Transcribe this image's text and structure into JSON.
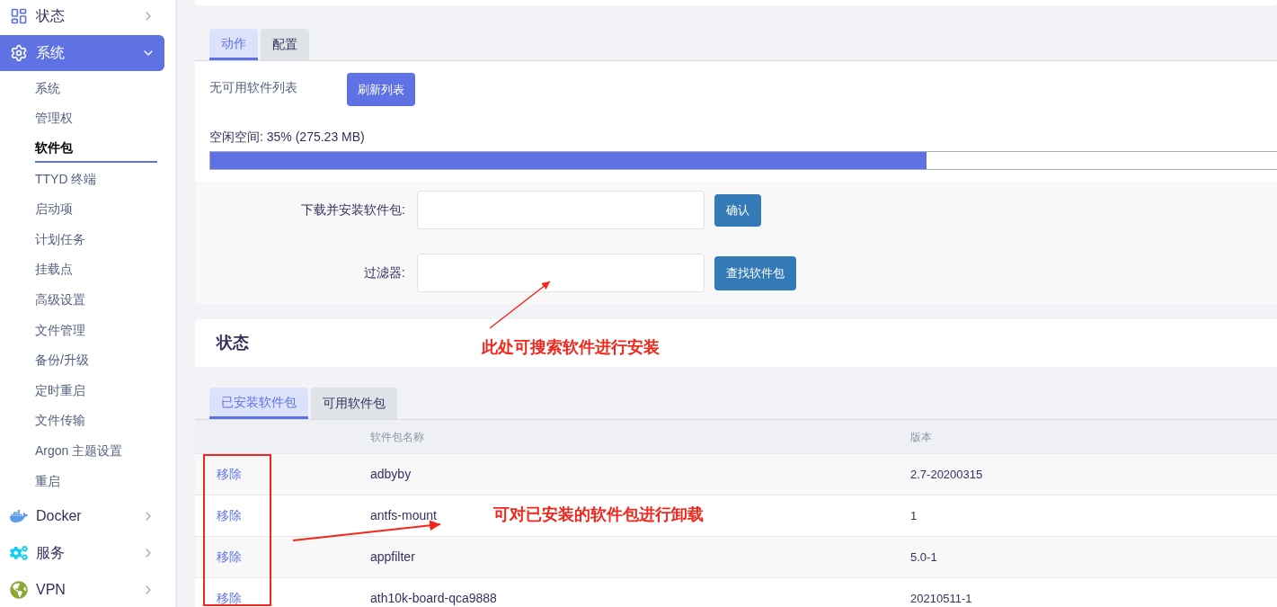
{
  "sidebar": {
    "items": [
      {
        "label": "状态",
        "selected": false,
        "expanded": false
      },
      {
        "label": "系统",
        "selected": true,
        "expanded": true,
        "children": [
          {
            "label": "系统",
            "selected": false
          },
          {
            "label": "管理权",
            "selected": false
          },
          {
            "label": "软件包",
            "selected": true
          },
          {
            "label": "TTYD 终端",
            "selected": false
          },
          {
            "label": "启动项",
            "selected": false
          },
          {
            "label": "计划任务",
            "selected": false
          },
          {
            "label": "挂载点",
            "selected": false
          },
          {
            "label": "高级设置",
            "selected": false
          },
          {
            "label": "文件管理",
            "selected": false
          },
          {
            "label": "备份/升级",
            "selected": false
          },
          {
            "label": "定时重启",
            "selected": false
          },
          {
            "label": "文件传输",
            "selected": false
          },
          {
            "label": "Argon 主题设置",
            "selected": false
          },
          {
            "label": "重启",
            "selected": false
          }
        ]
      },
      {
        "label": "Docker",
        "selected": false,
        "expanded": false
      },
      {
        "label": "服务",
        "selected": false,
        "expanded": false
      },
      {
        "label": "VPN",
        "selected": false,
        "expanded": false
      }
    ]
  },
  "action_tabs": [
    {
      "label": "动作",
      "selected": true
    },
    {
      "label": "配置",
      "selected": false
    }
  ],
  "actions": {
    "no_list_text": "无可用软件列表",
    "refresh_button": "刷新列表",
    "free_space_label": "空闲空间: 35% (275.23 MB)",
    "usage": {
      "level": 0.67
    },
    "form": [
      {
        "label": "下载并安装软件包:",
        "button": "确认"
      },
      {
        "label": "过滤器:",
        "button": "查找软件包"
      }
    ]
  },
  "status": {
    "title": "状态"
  },
  "package_tabs": [
    {
      "label": "已安装软件包",
      "selected": true
    },
    {
      "label": "可用软件包",
      "selected": false
    }
  ],
  "table": {
    "columns": [
      "软件包名称",
      "版本"
    ],
    "rows": [
      {
        "action": "移除",
        "name": "adbyby",
        "version": "2.7-20200315"
      },
      {
        "action": "移除",
        "name": "antfs-mount",
        "version": "1"
      },
      {
        "action": "移除",
        "name": "appfilter",
        "version": "5.0-1"
      },
      {
        "action": "移除",
        "name": "ath10k-board-qca9888",
        "version": "20210511-1"
      }
    ]
  },
  "annotations": [
    "此处可搜索软件进行安装",
    "可对已安装的软件包进行卸载"
  ]
}
